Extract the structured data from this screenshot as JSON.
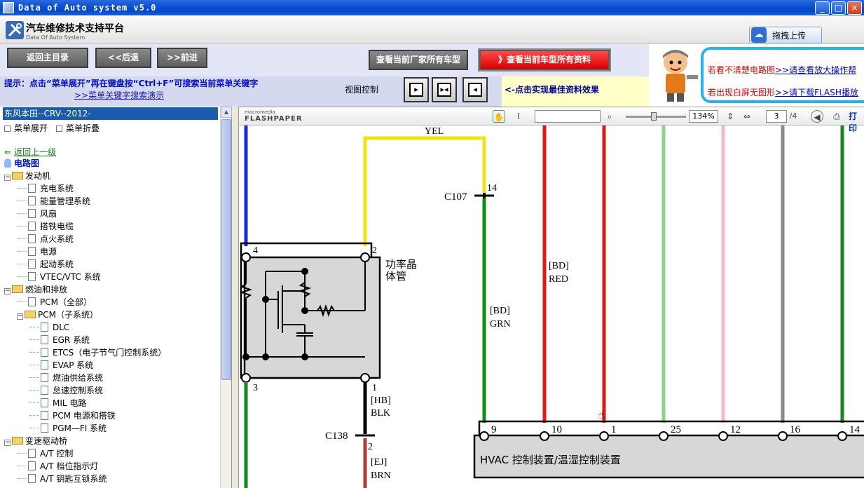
{
  "window": {
    "title": "Data of Auto system v5.0",
    "controls": [
      "_",
      "□",
      "×"
    ]
  },
  "header": {
    "title": "汽车维修技术支持平台",
    "subtitle": "Data Of Auto System",
    "upload_label": "拖拽上传"
  },
  "toolbar": {
    "home_label": "返回主目录",
    "back_label": "<<后退",
    "forward_label": ">>前进",
    "all_models_label": "查看当前厂家所有车型",
    "all_data_label": "》查看当前车型所有资料",
    "hint": "提示：点击“菜单展开”再在键盘按“Ctrl+F”可搜索当前菜单关键字",
    "hint_link": ">>菜单关键字搜索演示",
    "view_label": "视图控制",
    "best_tip": "<-点击实现最佳资料效果",
    "ad_line1": "若看不清楚电路图",
    "ad_link1": ">>请查看放大操作帮",
    "ad_line2": "若出现白屏无图形",
    "ad_link2": ">>请下载FLASH播放"
  },
  "sidebar": {
    "selected": "东风本田--CRV--2012-",
    "expand_label": "菜单展开",
    "collapse_label": "菜单折叠",
    "back_label": "返回上一级",
    "root": "电路图",
    "tree": [
      {
        "label": "发动机",
        "type": "folder",
        "level": 0
      },
      {
        "label": "充电系统",
        "type": "doc",
        "level": 1
      },
      {
        "label": "能量管理系统",
        "type": "doc",
        "level": 1
      },
      {
        "label": "风扇",
        "type": "doc",
        "level": 1
      },
      {
        "label": "搭铁电缆",
        "type": "doc",
        "level": 1
      },
      {
        "label": "点火系统",
        "type": "doc",
        "level": 1
      },
      {
        "label": "电源",
        "type": "doc",
        "level": 1
      },
      {
        "label": "起动系统",
        "type": "doc",
        "level": 1
      },
      {
        "label": "VTEC/VTC 系统",
        "type": "doc",
        "level": 1
      },
      {
        "label": "燃油和排放",
        "type": "folder",
        "level": 0
      },
      {
        "label": "PCM（全部）",
        "type": "doc",
        "level": 1
      },
      {
        "label": "PCM（子系统）",
        "type": "folder",
        "level": 1
      },
      {
        "label": "DLC",
        "type": "doc",
        "level": 2
      },
      {
        "label": "EGR 系统",
        "type": "doc",
        "level": 2
      },
      {
        "label": "ETCS（电子节气门控制系统）",
        "type": "doc",
        "level": 2
      },
      {
        "label": "EVAP 系统",
        "type": "doc",
        "level": 2
      },
      {
        "label": "燃油供给系统",
        "type": "doc",
        "level": 2
      },
      {
        "label": "怠速控制系统",
        "type": "doc",
        "level": 2
      },
      {
        "label": "MIL 电路",
        "type": "doc",
        "level": 2
      },
      {
        "label": "PCM 电源和搭铁",
        "type": "doc",
        "level": 2
      },
      {
        "label": "PGM—FI 系统",
        "type": "doc",
        "level": 2
      },
      {
        "label": "变速驱动桥",
        "type": "folder",
        "level": 0
      },
      {
        "label": "A/T 控制",
        "type": "doc",
        "level": 1
      },
      {
        "label": "A/T 档位指示灯",
        "type": "doc",
        "level": 1
      },
      {
        "label": "A/T 钥匙互锁系统",
        "type": "doc",
        "level": 1
      }
    ]
  },
  "viewer": {
    "brand_top": "macromedia",
    "brand": "FLASHPAPER",
    "zoom": "134%",
    "page": "3",
    "page_total": "/4",
    "print_label": "打印"
  },
  "diagram": {
    "wire_top_label": "YEL",
    "c107": "C107",
    "c107_pin": "14",
    "module_pin_4": "4",
    "module_pin_2": "2",
    "module_pin_3": "3",
    "module_pin_1": "1",
    "module_label_1": "功率晶",
    "module_label_2": "体管",
    "hb": "[HB]",
    "blk": "BLK",
    "c138": "C138",
    "c138_pin": "2",
    "ej": "[EJ]",
    "brn": "BRN",
    "bd_grn": "[BD]",
    "grn": "GRN",
    "bd_red": "[BD]",
    "red": "RED",
    "hvac_label": "HVAC 控制装置/温湿控制装置",
    "hvac_pins": [
      "9",
      "10",
      "1",
      "25",
      "12",
      "16",
      "14"
    ],
    "colors": {
      "blue": "#1a2ad8",
      "yellow": "#f0e21a",
      "green": "#118a1a",
      "lightgreen": "#8fd08f",
      "red": "#e01818",
      "pink": "#f4b8c8",
      "gray": "#8a8a8a",
      "brown": "#b03a3a"
    }
  }
}
